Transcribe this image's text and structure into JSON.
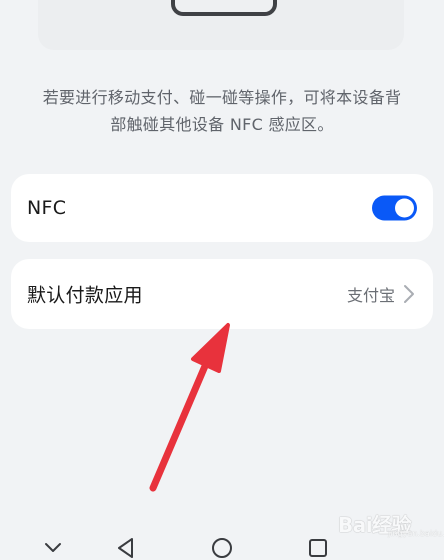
{
  "description": {
    "line1": "若要进行移动支付、碰一碰等操作，可将本设备背",
    "line2": "部触碰其他设备 NFC 感应区。"
  },
  "nfc_row": {
    "label": "NFC",
    "toggle_on": true
  },
  "payment_row": {
    "label": "默认付款应用",
    "value": "支付宝"
  },
  "watermark": {
    "text": "Bai经验",
    "subtext": "jingyan.baidu.com"
  },
  "colors": {
    "background": "#f1f3f5",
    "card": "#ffffff",
    "toggle_accent": "#0a59f7",
    "arrow": "#e8323c"
  },
  "icons": {
    "chevron": "chevron-right-icon",
    "nav_down": "chevron-down-icon",
    "nav_back": "triangle-back-icon",
    "nav_home": "circle-home-icon",
    "nav_recent": "square-recent-icon"
  }
}
